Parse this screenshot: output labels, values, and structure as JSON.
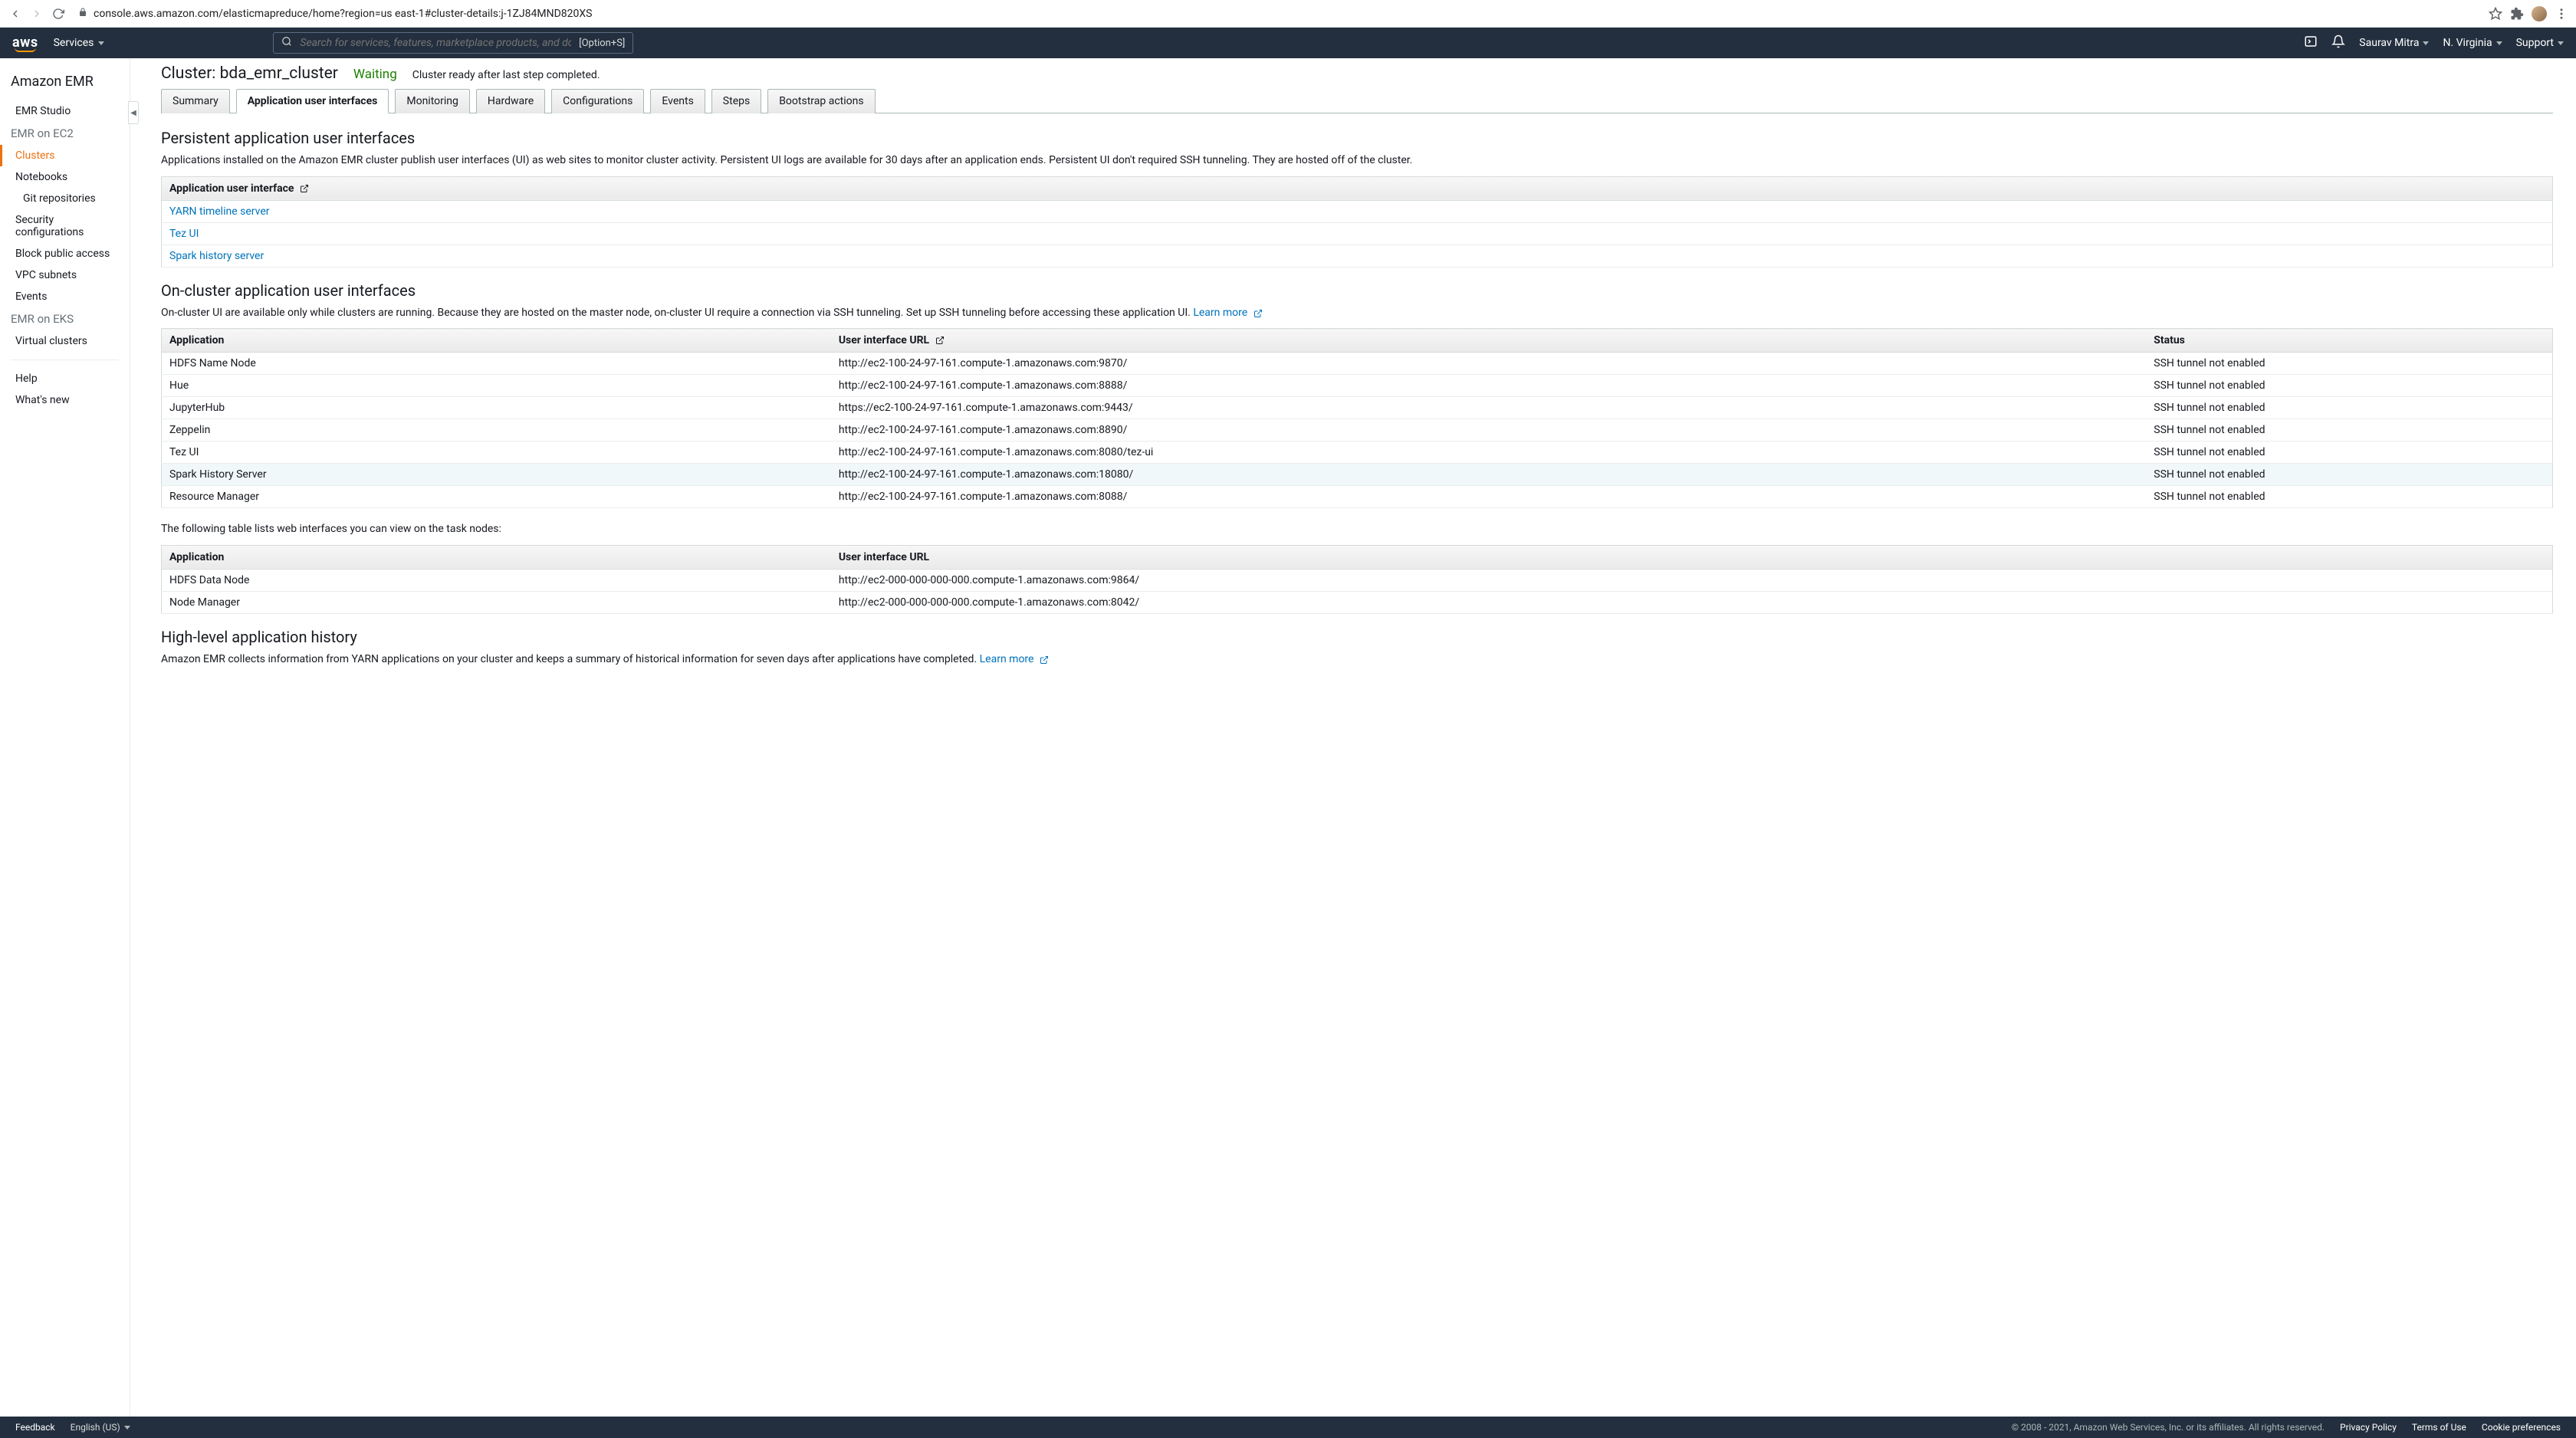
{
  "browser": {
    "url": "console.aws.amazon.com/elasticmapreduce/home?region=us east-1#cluster-details:j-1ZJ84MND820XS"
  },
  "topnav": {
    "services": "Services",
    "search_placeholder": "Search for services, features, marketplace products, and docs",
    "search_shortcut": "[Option+S]",
    "user": "Saurav Mitra",
    "region": "N. Virginia",
    "support": "Support"
  },
  "sidebar": {
    "title": "Amazon EMR",
    "items": [
      {
        "label": "EMR Studio",
        "type": "item"
      },
      {
        "label": "EMR on EC2",
        "type": "section"
      },
      {
        "label": "Clusters",
        "type": "item",
        "active": true
      },
      {
        "label": "Notebooks",
        "type": "item"
      },
      {
        "label": "Git repositories",
        "type": "item",
        "indent": true
      },
      {
        "label": "Security configurations",
        "type": "item"
      },
      {
        "label": "Block public access",
        "type": "item"
      },
      {
        "label": "VPC subnets",
        "type": "item"
      },
      {
        "label": "Events",
        "type": "item"
      },
      {
        "label": "EMR on EKS",
        "type": "section"
      },
      {
        "label": "Virtual clusters",
        "type": "item"
      }
    ],
    "bottom": [
      {
        "label": "Help"
      },
      {
        "label": "What's new"
      }
    ]
  },
  "header": {
    "title": "Cluster: bda_emr_cluster",
    "status": "Waiting",
    "status_msg": "Cluster ready after last step completed."
  },
  "tabs": [
    {
      "label": "Summary"
    },
    {
      "label": "Application user interfaces",
      "active": true
    },
    {
      "label": "Monitoring"
    },
    {
      "label": "Hardware"
    },
    {
      "label": "Configurations"
    },
    {
      "label": "Events"
    },
    {
      "label": "Steps"
    },
    {
      "label": "Bootstrap actions"
    }
  ],
  "persistent": {
    "heading": "Persistent application user interfaces",
    "desc": "Applications installed on the Amazon EMR cluster publish user interfaces (UI) as web sites to monitor cluster activity. Persistent UI logs are available for 30 days after an application ends. Persistent UI don't required SSH tunneling. They are hosted off of the cluster.",
    "col": "Application user interface",
    "rows": [
      {
        "name": "YARN timeline server"
      },
      {
        "name": "Tez UI"
      },
      {
        "name": "Spark history server"
      }
    ]
  },
  "oncluster": {
    "heading": "On-cluster application user interfaces",
    "desc": "On-cluster UI are available only while clusters are running. Because they are hosted on the master node, on-cluster UI require a connection via SSH tunneling. Set up SSH tunneling before accessing these application UI.",
    "learn_more": "Learn more",
    "cols": {
      "app": "Application",
      "url": "User interface URL",
      "status": "Status"
    },
    "rows": [
      {
        "app": "HDFS Name Node",
        "url": "http://ec2-100-24-97-161.compute-1.amazonaws.com:9870/",
        "status": "SSH tunnel not enabled"
      },
      {
        "app": "Hue",
        "url": "http://ec2-100-24-97-161.compute-1.amazonaws.com:8888/",
        "status": "SSH tunnel not enabled"
      },
      {
        "app": "JupyterHub",
        "url": "https://ec2-100-24-97-161.compute-1.amazonaws.com:9443/",
        "status": "SSH tunnel not enabled"
      },
      {
        "app": "Zeppelin",
        "url": "http://ec2-100-24-97-161.compute-1.amazonaws.com:8890/",
        "status": "SSH tunnel not enabled"
      },
      {
        "app": "Tez UI",
        "url": "http://ec2-100-24-97-161.compute-1.amazonaws.com:8080/tez-ui",
        "status": "SSH tunnel not enabled"
      },
      {
        "app": "Spark History Server",
        "url": "http://ec2-100-24-97-161.compute-1.amazonaws.com:18080/",
        "status": "SSH tunnel not enabled",
        "highlight": true
      },
      {
        "app": "Resource Manager",
        "url": "http://ec2-100-24-97-161.compute-1.amazonaws.com:8088/",
        "status": "SSH tunnel not enabled"
      }
    ]
  },
  "tasknodes": {
    "intro": "The following table lists web interfaces you can view on the task nodes:",
    "cols": {
      "app": "Application",
      "url": "User interface URL"
    },
    "rows": [
      {
        "app": "HDFS Data Node",
        "url": "http://ec2-000-000-000-000.compute-1.amazonaws.com:9864/"
      },
      {
        "app": "Node Manager",
        "url": "http://ec2-000-000-000-000.compute-1.amazonaws.com:8042/"
      }
    ]
  },
  "history": {
    "heading": "High-level application history",
    "desc": "Amazon EMR collects information from YARN applications on your cluster and keeps a summary of historical information for seven days after applications have completed.",
    "learn_more": "Learn more"
  },
  "footer": {
    "feedback": "Feedback",
    "language": "English (US)",
    "copyright": "© 2008 - 2021, Amazon Web Services, Inc. or its affiliates. All rights reserved.",
    "privacy": "Privacy Policy",
    "terms": "Terms of Use",
    "cookies": "Cookie preferences"
  }
}
